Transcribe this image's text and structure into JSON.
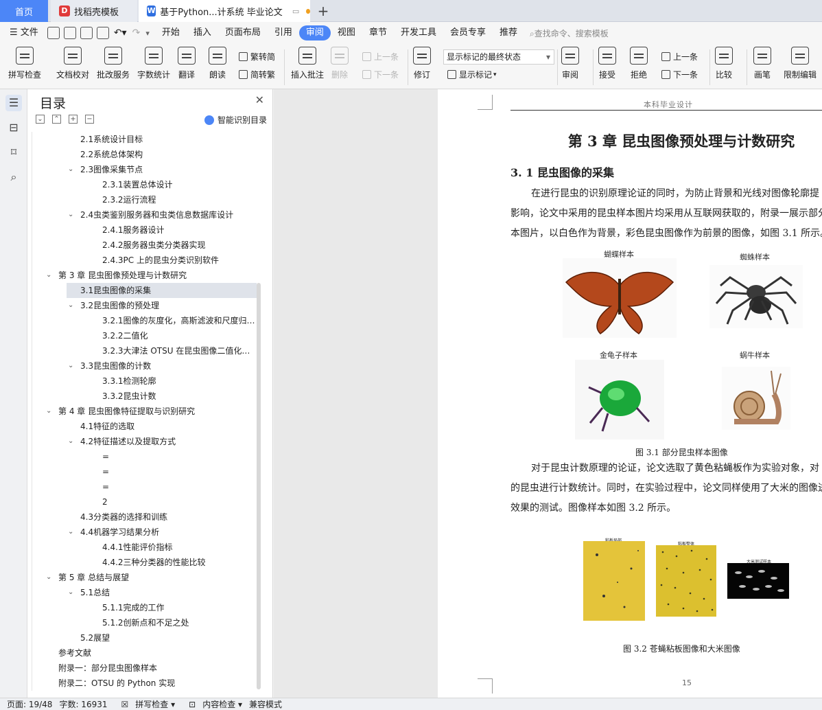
{
  "tabs": {
    "home": "首页",
    "template": "找稻壳模板",
    "doc": "基于Python...计系统 毕业论文"
  },
  "menubar": {
    "file": "文件",
    "items": [
      "开始",
      "插入",
      "页面布局",
      "引用",
      "审阅",
      "视图",
      "章节",
      "开发工具",
      "会员专享",
      "推荐"
    ],
    "active": "审阅",
    "search": "查找命令、搜索模板"
  },
  "ribbon": {
    "spell": "拼写检查",
    "doc_check": "文档校对",
    "correct": "批改服务",
    "wordcount": "字数统计",
    "translate": "翻译",
    "read": "朗读",
    "trad": "繁转简",
    "simp": "简转繁",
    "add_comment": "插入批注",
    "delete": "删除",
    "prev": "上一条",
    "next": "下一条",
    "revise": "修订",
    "markup_state": "显示标记的最终状态",
    "show_markup": "显示标记",
    "review": "审阅",
    "accept": "接受",
    "reject": "拒绝",
    "prev2": "上一条",
    "next2": "下一条",
    "compare": "比较",
    "pen": "画笔",
    "restrict": "限制编辑"
  },
  "toc": {
    "title": "目录",
    "smart": "智能识别目录",
    "items": [
      {
        "text": "2.1系统设计目标",
        "level": 2
      },
      {
        "text": "2.2系统总体架构",
        "level": 2
      },
      {
        "text": "2.3图像采集节点",
        "level": 2,
        "exp": true
      },
      {
        "text": "2.3.1装置总体设计",
        "level": 3
      },
      {
        "text": "2.3.2运行流程",
        "level": 3
      },
      {
        "text": "2.4虫类鉴别服务器和虫类信息数据库设计",
        "level": 2,
        "exp": true
      },
      {
        "text": "2.4.1服务器设计",
        "level": 3
      },
      {
        "text": "2.4.2服务器虫类分类器实现",
        "level": 3
      },
      {
        "text": "2.4.3PC 上的昆虫分类识别软件",
        "level": 3
      },
      {
        "text": "第 3 章 昆虫图像预处理与计数研究",
        "level": 1,
        "exp": true
      },
      {
        "text": "3.1昆虫图像的采集",
        "level": 2,
        "sel": true
      },
      {
        "text": "3.2昆虫图像的预处理",
        "level": 2,
        "exp": true
      },
      {
        "text": "3.2.1图像的灰度化，高斯滤波和尺度归一化",
        "level": 3
      },
      {
        "text": "3.2.2二值化",
        "level": 3
      },
      {
        "text": "3.2.3大津法 OTSU 在昆虫图像二值化中的应用",
        "level": 3
      },
      {
        "text": "3.3昆虫图像的计数",
        "level": 2,
        "exp": true
      },
      {
        "text": "3.3.1检测轮廓",
        "level": 3
      },
      {
        "text": "3.3.2昆虫计数",
        "level": 3
      },
      {
        "text": "第 4 章 昆虫图像特征提取与识别研究",
        "level": 1,
        "exp": true
      },
      {
        "text": "4.1特征的选取",
        "level": 2
      },
      {
        "text": "4.2特征描述以及提取方式",
        "level": 2,
        "exp": true
      },
      {
        "text": "=",
        "level": 3
      },
      {
        "text": "=",
        "level": 3
      },
      {
        "text": "=",
        "level": 3
      },
      {
        "text": "2",
        "level": 3
      },
      {
        "text": "4.3分类器的选择和训练",
        "level": 2
      },
      {
        "text": "4.4机器学习结果分析",
        "level": 2,
        "exp": true
      },
      {
        "text": "4.4.1性能评价指标",
        "level": 3
      },
      {
        "text": "4.4.2三种分类器的性能比较",
        "level": 3
      },
      {
        "text": "第 5 章 总结与展望",
        "level": 1,
        "exp": true
      },
      {
        "text": "5.1总结",
        "level": 2,
        "exp": true
      },
      {
        "text": "5.1.1完成的工作",
        "level": 3
      },
      {
        "text": "5.1.2创新点和不足之处",
        "level": 3
      },
      {
        "text": "5.2展望",
        "level": 2
      },
      {
        "text": "参考文献",
        "level": 0
      },
      {
        "text": "附录一：部分昆虫图像样本",
        "level": 0
      },
      {
        "text": "附录二：OTSU 的 Python 实现",
        "level": 0
      }
    ]
  },
  "doc": {
    "header": "本科毕业设计",
    "chapter_title": "第 3 章 昆虫图像预处理与计数研究",
    "section_title": "3. 1 昆虫图像的采集",
    "para1": [
      "在进行昆虫的识别原理论证的同时，为防止背景和光线对图像轮廓提",
      "影响，论文中采用的昆虫样本图片均采用从互联网获取的，附录一展示部分",
      "本图片，以白色作为背景，彩色昆虫图像作为前景的图像，如图 3.1 所示。"
    ],
    "labels": {
      "butterfly": "蝴蝶样本",
      "spider": "蜘蛛样本",
      "beetle": "金龟子样本",
      "snail": "蜗牛样本"
    },
    "fig1": "图 3.1 部分昆虫样本图像",
    "para2": [
      "对于昆虫计数原理的论证，论文选取了黄色粘蝇板作为实验对象，对",
      "的昆虫进行计数统计。同时，在实验过程中，论文同样使用了大米的图像进",
      "效果的测试。图像样本如图 3.2 所示。"
    ],
    "fig2_labels": {
      "a": "粘板局部",
      "b": "粘板整体",
      "c": "大米测试样本"
    },
    "fig2": "图 3.2 苍蝇粘板图像和大米图像",
    "page_number": "15"
  },
  "status": {
    "page": "页面: 19/48",
    "words": "字数: 16931",
    "spell": "拼写检查",
    "content": "内容检查",
    "compat": "兼容模式"
  },
  "colors": {
    "accent": "#4c86f7",
    "tab_bar": "#dfe3ea"
  }
}
